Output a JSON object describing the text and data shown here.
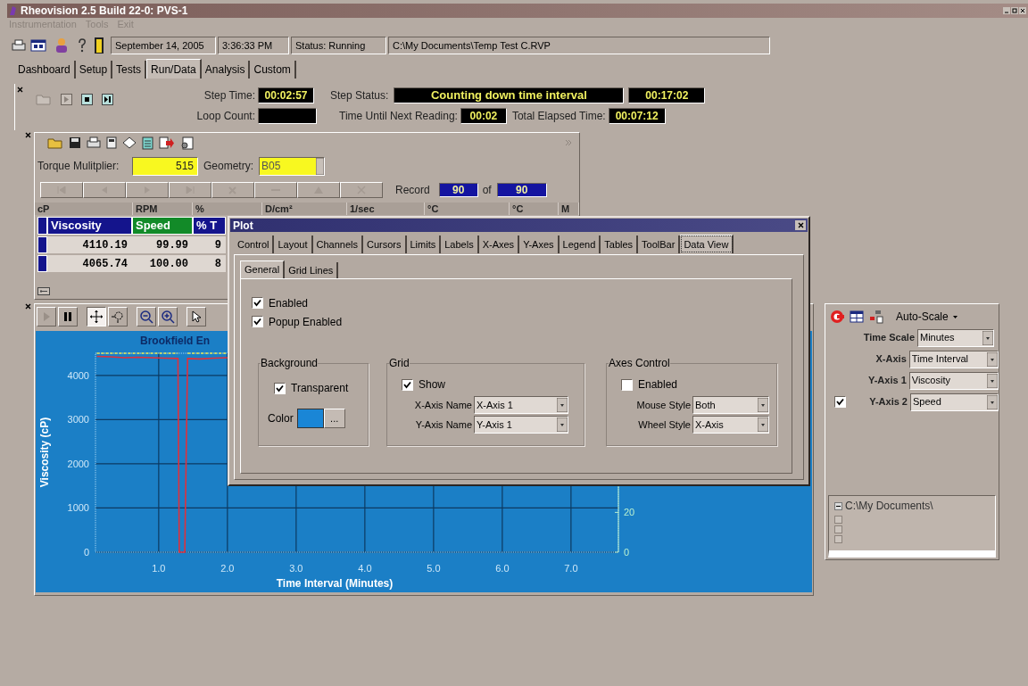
{
  "window": {
    "title": "Rheovision 2.5 Build 22-0: PVS-1"
  },
  "menu": [
    {
      "label": "Instrumentation",
      "disabled": true
    },
    {
      "label": "Tools",
      "disabled": true
    },
    {
      "label": "Exit",
      "disabled": true
    }
  ],
  "status_fields": [
    "September 14, 2005",
    "3:36:33 PM",
    "Status: Running",
    "C:\\My Documents\\Temp Test C.RVP"
  ],
  "tabs": [
    {
      "label": "Dashboard",
      "selected": false
    },
    {
      "label": "Setup",
      "selected": false
    },
    {
      "label": "Tests",
      "selected": false
    },
    {
      "label": "Run/Data",
      "selected": true
    },
    {
      "label": "Analysis",
      "selected": false
    },
    {
      "label": "Custom",
      "selected": false
    }
  ],
  "run_panel": {
    "step_time_label": "Step Time:",
    "step_time": "00:02:57",
    "loop_count_label": "Loop Count:",
    "step_status_label": "Step Status:",
    "step_status": "Counting down time interval",
    "step_remaining": "00:17:02",
    "next_reading_label": "Time Until Next Reading:",
    "next_reading": "00:02",
    "elapsed_label": "Total Elapsed Time:",
    "elapsed": "00:07:12"
  },
  "data_panel": {
    "torque_label": "Torque Mulitplier:",
    "torque": "515",
    "geometry_label": "Geometry:",
    "geometry": "B05",
    "record_label": "Record",
    "record": "90",
    "of_label": "of",
    "record_total": "90",
    "units": [
      "cP",
      "RPM",
      "%",
      "D/cm²",
      "1/sec",
      "°C",
      "°C",
      "M"
    ],
    "columns": [
      {
        "label": "Viscosity",
        "color": "#14148c"
      },
      {
        "label": "Speed",
        "color": "#128a28"
      },
      {
        "label": "% T",
        "color": "#14148c"
      }
    ],
    "rows": [
      [
        "4110.19",
        "99.99",
        "9"
      ],
      [
        "4065.74",
        "100.00",
        "8"
      ]
    ]
  },
  "plot": {
    "chart_data": {
      "type": "line",
      "title": "Brookfield En",
      "xlabel": "Time Interval (Minutes)",
      "ylabel": "Viscosity (cP)",
      "x": [
        0.1,
        0.3,
        0.5,
        0.7,
        0.9,
        1.1,
        1.28,
        1.3,
        1.38,
        1.42,
        1.6,
        1.8,
        2.0
      ],
      "series": [
        {
          "color": "#e0303c",
          "line_style": "solid",
          "values": [
            4430,
            4420,
            4400,
            4410,
            4400,
            4390,
            4380,
            0,
            0,
            4380,
            4370,
            4390,
            4400
          ]
        },
        {
          "color": "#e8e850",
          "line_style": "dashed",
          "axis": "y2",
          "values": [
            100,
            100,
            100,
            100,
            100,
            100,
            100,
            null,
            null,
            100,
            100,
            100,
            100
          ]
        }
      ],
      "grid": true,
      "xlim": [
        0.08,
        7.69
      ],
      "ylim": [
        0,
        4500
      ],
      "y2lim": [
        0,
        100
      ],
      "xticks": [
        {
          "value": 1,
          "label": "1.0"
        },
        {
          "value": 2,
          "label": "2.0"
        },
        {
          "value": 3,
          "label": "3.0"
        },
        {
          "value": 4,
          "label": "4.0"
        },
        {
          "value": 5,
          "label": "5.0"
        },
        {
          "value": 6,
          "label": "6.0"
        },
        {
          "value": 7,
          "label": "7.0"
        }
      ],
      "yticks": [
        0,
        1000,
        2000,
        3000,
        4000
      ],
      "y2ticks": [
        0,
        20
      ]
    }
  },
  "right_panel": {
    "autoscale": "Auto-Scale",
    "fields": [
      {
        "label": "Time Scale",
        "value": "Minutes"
      },
      {
        "label": "X-Axis",
        "value": "Time Interval"
      },
      {
        "label": "Y-Axis 1",
        "value": "Viscosity"
      }
    ],
    "y_axis_2": {
      "label": "Y-Axis 2",
      "value": "Speed",
      "checked": true
    },
    "tree": [
      {
        "label": "C:\\My Documents\\",
        "expanded": true
      }
    ]
  },
  "dialog": {
    "title": "Plot",
    "tabs": [
      {
        "label": "Control",
        "selected": false
      },
      {
        "label": "Layout",
        "selected": false
      },
      {
        "label": "Channels",
        "selected": false
      },
      {
        "label": "Cursors",
        "selected": false
      },
      {
        "label": "Limits",
        "selected": false
      },
      {
        "label": "Labels",
        "selected": false
      },
      {
        "label": "X-Axes",
        "selected": false
      },
      {
        "label": "Y-Axes",
        "selected": false
      },
      {
        "label": "Legend",
        "selected": false
      },
      {
        "label": "Tables",
        "selected": false
      },
      {
        "label": "ToolBar",
        "selected": false
      },
      {
        "label": "Data View",
        "selected": true
      }
    ],
    "subtabs": [
      {
        "label": "General",
        "selected": true
      },
      {
        "label": "Grid Lines",
        "selected": false
      }
    ],
    "options": [
      {
        "label": "Enabled",
        "checked": true
      },
      {
        "label": "Popup Enabled",
        "checked": true
      }
    ],
    "background": {
      "title": "Background",
      "transparent": {
        "label": "Transparent",
        "checked": true
      },
      "color_label": "Color",
      "color": "#1a86d6",
      "browse": "..."
    },
    "grid": {
      "title": "Grid",
      "show": {
        "label": "Show",
        "checked": true
      },
      "x_axis_name_label": "X-Axis Name",
      "x_axis_name": "X-Axis 1",
      "y_axis_name_label": "Y-Axis Name",
      "y_axis_name": "Y-Axis 1"
    },
    "axes_control": {
      "title": "Axes Control",
      "enabled": {
        "label": "Enabled",
        "checked": false
      },
      "mouse_style_label": "Mouse Style",
      "mouse_style": "Both",
      "wheel_style_label": "Wheel Style",
      "wheel_style": "X-Axis"
    }
  }
}
